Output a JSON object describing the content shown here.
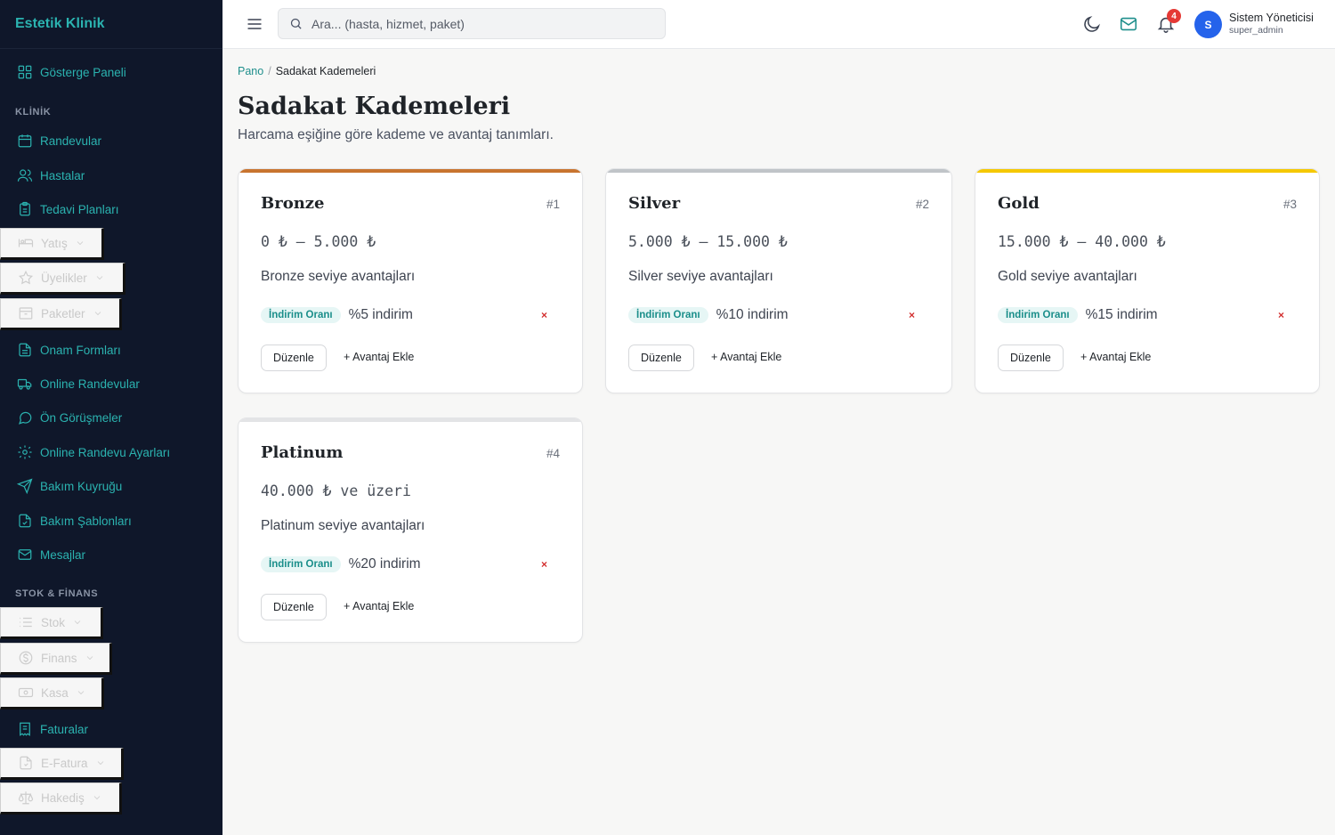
{
  "app": {
    "brand": "Estetik Klinik"
  },
  "sidebar": {
    "items": [
      {
        "label": "Gösterge Paneli",
        "icon": "grid-icon"
      },
      {
        "label": "Randevular",
        "icon": "calendar-icon"
      },
      {
        "label": "Hastalar",
        "icon": "users-icon"
      },
      {
        "label": "Tedavi Planları",
        "icon": "clipboard-icon"
      },
      {
        "label": "Yatış",
        "icon": "bed-icon"
      },
      {
        "label": "Üyelikler",
        "icon": "star-icon"
      },
      {
        "label": "Paketler",
        "icon": "package-icon"
      },
      {
        "label": "Onam Formları",
        "icon": "file-text-icon"
      },
      {
        "label": "Online Randevular",
        "icon": "truck-icon"
      },
      {
        "label": "Ön Görüşmeler",
        "icon": "message-circle-icon"
      },
      {
        "label": "Online Randevu Ayarları",
        "icon": "settings-icon"
      },
      {
        "label": "Bakım Kuyruğu",
        "icon": "send-icon"
      },
      {
        "label": "Bakım Şablonları",
        "icon": "file-check-icon"
      },
      {
        "label": "Mesajlar",
        "icon": "mail-icon"
      },
      {
        "label": "Stok",
        "icon": "list-icon"
      },
      {
        "label": "Finans",
        "icon": "dollar-circle-icon"
      },
      {
        "label": "Kasa",
        "icon": "banknote-icon"
      },
      {
        "label": "Faturalar",
        "icon": "receipt-icon"
      },
      {
        "label": "E-Fatura",
        "icon": "file-invoice-icon"
      },
      {
        "label": "Hakediş",
        "icon": "scale-icon"
      }
    ],
    "sections": {
      "clinic": "KLİNİK",
      "stock_finance": "STOK & FİNANS"
    }
  },
  "topbar": {
    "search_placeholder": "Ara... (hasta, hizmet, paket)",
    "notification_count": "4",
    "user": {
      "initial": "S",
      "name": "Sistem Yöneticisi",
      "role": "super_admin"
    }
  },
  "breadcrumb": {
    "root": "Pano",
    "current": "Sadakat Kademeleri"
  },
  "page": {
    "title": "Sadakat Kademeleri",
    "subtitle": "Harcama eşiğine göre kademe ve avantaj tanımları."
  },
  "tiers": [
    {
      "name": "Bronze",
      "rank": "#1",
      "range": "0 ₺ – 5.000 ₺",
      "description": "Bronze seviye avantajları",
      "benefit_tag": "İndirim Oranı",
      "benefit_value": "%5 indirim",
      "color": "#c8742f"
    },
    {
      "name": "Silver",
      "rank": "#2",
      "range": "5.000 ₺ – 15.000 ₺",
      "description": "Silver seviye avantajları",
      "benefit_tag": "İndirim Oranı",
      "benefit_value": "%10 indirim",
      "color": "#c0c4c8"
    },
    {
      "name": "Gold",
      "rank": "#3",
      "range": "15.000 ₺ – 40.000 ₺",
      "description": "Gold seviye avantajları",
      "benefit_tag": "İndirim Oranı",
      "benefit_value": "%15 indirim",
      "color": "#f5c800"
    },
    {
      "name": "Platinum",
      "rank": "#4",
      "range": "40.000 ₺ ve üzeri",
      "description": "Platinum seviye avantajları",
      "benefit_tag": "İndirim Oranı",
      "benefit_value": "%20 indirim",
      "color": "#e3e4e6"
    }
  ],
  "card_actions": {
    "edit": "Düzenle",
    "add_benefit": "+ Avantaj Ekle",
    "delete": "×"
  }
}
